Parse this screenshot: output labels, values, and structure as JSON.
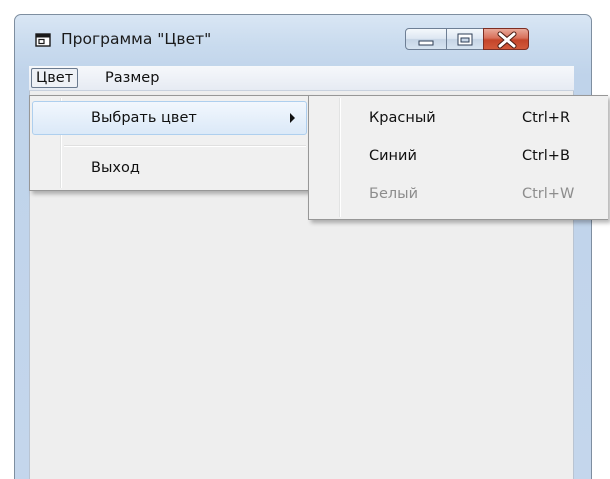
{
  "window": {
    "title": "Программа \"Цвет\"",
    "icon": "app-window-icon",
    "caption_buttons": [
      "minimize-icon",
      "maximize-icon",
      "close-icon"
    ]
  },
  "menubar": {
    "items": [
      {
        "label": "Цвет",
        "state": "open"
      },
      {
        "label": "Размер"
      }
    ]
  },
  "dropdown": {
    "items": [
      {
        "label": "Выбрать цвет",
        "has_submenu": true,
        "state": "highlighted"
      },
      {
        "type": "separator"
      },
      {
        "label": "Выход"
      }
    ]
  },
  "submenu": {
    "items": [
      {
        "label": "Красный",
        "shortcut": "Ctrl+R",
        "enabled": true
      },
      {
        "label": "Синий",
        "shortcut": "Ctrl+B",
        "enabled": true
      },
      {
        "label": "Белый",
        "shortcut": "Ctrl+W",
        "enabled": false
      }
    ]
  },
  "colors": {
    "frame": "#c9dbee",
    "client": "#eeeeee",
    "menu_bg": "#f0f0f0",
    "highlight": "#dbe9f8",
    "disabled_text": "#8d8d8d",
    "close_button": "#c4452a"
  }
}
